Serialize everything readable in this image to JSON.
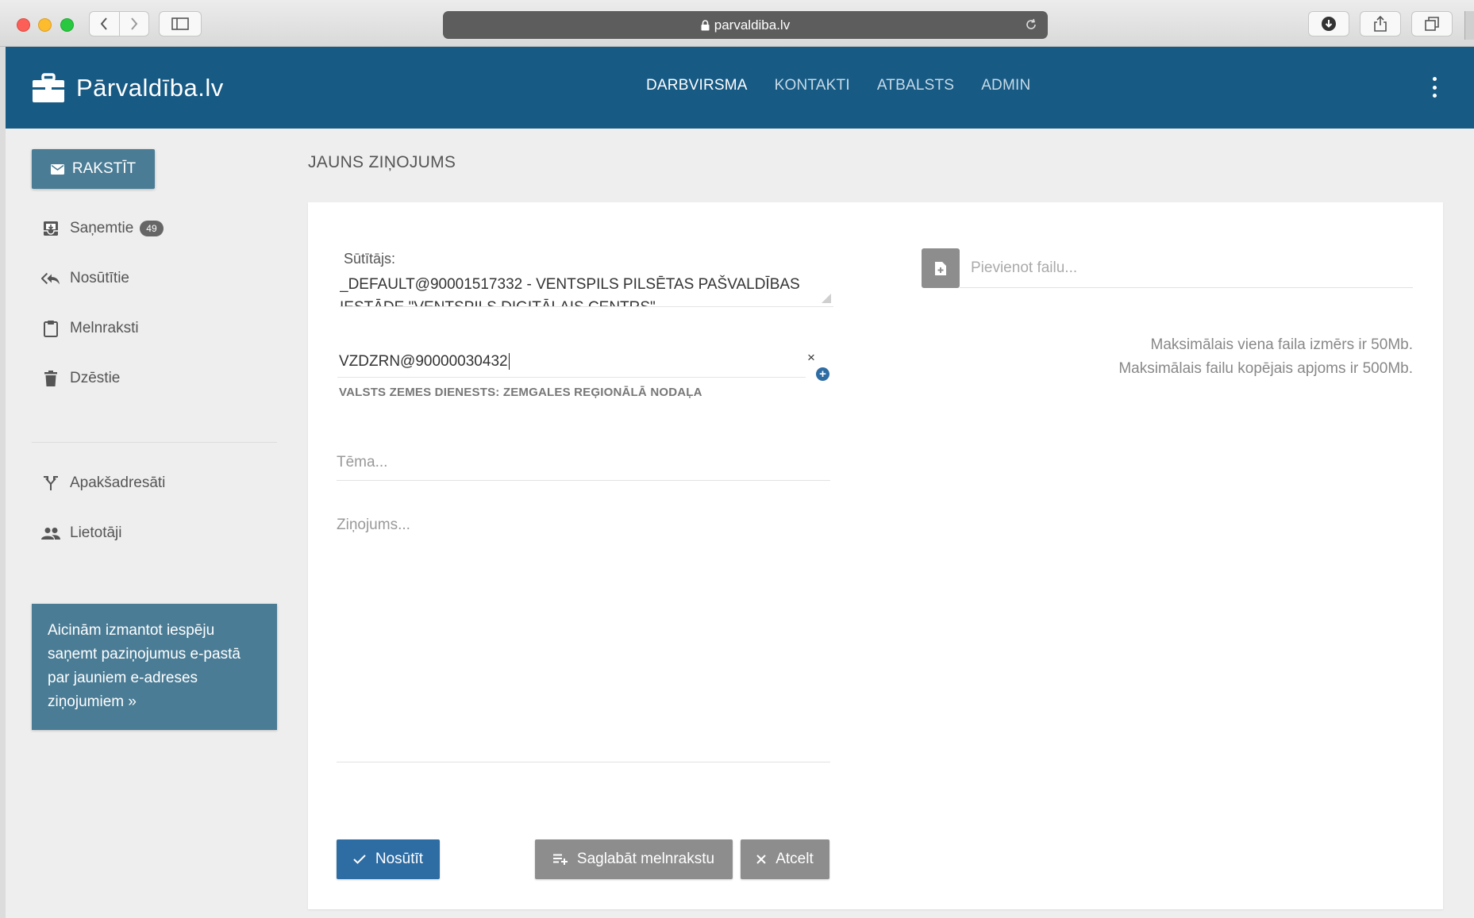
{
  "browser": {
    "url": "parvaldiba.lv"
  },
  "header": {
    "logo_text": "Pārvaldība.lv",
    "nav": [
      {
        "label": "DARBVIRSMA",
        "active": true
      },
      {
        "label": "KONTAKTI",
        "active": false
      },
      {
        "label": "ATBALSTS",
        "active": false
      },
      {
        "label": "ADMIN",
        "active": false
      }
    ]
  },
  "sidebar": {
    "compose_label": "RAKSTĪT",
    "items": [
      {
        "label": "Saņemtie",
        "icon": "inbox-icon",
        "badge": "49"
      },
      {
        "label": "Nosūtītie",
        "icon": "reply-all-icon"
      },
      {
        "label": "Melnraksti",
        "icon": "clipboard-icon"
      },
      {
        "label": "Dzēstie",
        "icon": "trash-icon"
      },
      {
        "label": "Apakšadresāti",
        "icon": "call-split-icon"
      },
      {
        "label": "Lietotāji",
        "icon": "people-icon"
      }
    ],
    "info_box": "Aicinām izmantot iespēju saņemt paziņojumus e-pastā par jauniem e-adreses ziņojumiem »"
  },
  "main": {
    "page_title": "JAUNS ZIŅOJUMS",
    "sender": {
      "label": "Sūtītājs:",
      "value": "_DEFAULT@90001517332 - VENTSPILS PILSĒTAS PAŠVALDĪBAS IESTĀDE \"VENTSPILS DIGITĀLAIS CENTRS\""
    },
    "recipient": {
      "value": "VZDZRN@90000030432",
      "name": "VALSTS ZEMES DIENESTS: ZEMGALES REĢIONĀLĀ NODAĻA",
      "remove": "×",
      "add": "+"
    },
    "subject_placeholder": "Tēma...",
    "message_placeholder": "Ziņojums...",
    "buttons": {
      "send": "Nosūtīt",
      "save_draft": "Saglabāt melnrakstu",
      "cancel": "Atcelt"
    }
  },
  "attachments": {
    "placeholder": "Pievienot failu...",
    "limit_single": "Maksimālais viena faila izmērs ir 50Mb.",
    "limit_total": "Maksimālais failu kopējais apjoms ir 500Mb."
  },
  "colors": {
    "header": "#175a84",
    "sidebar_accent": "#4a7c95",
    "primary_button": "#2e6da4",
    "secondary_button": "#8d8d8d"
  }
}
